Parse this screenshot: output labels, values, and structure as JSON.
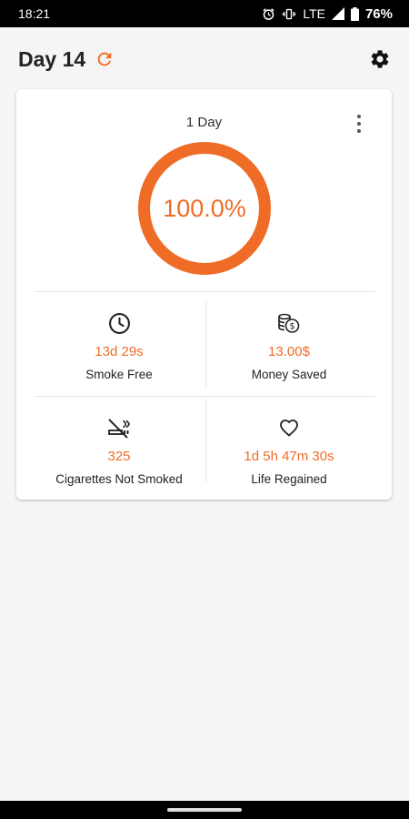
{
  "status_bar": {
    "time": "18:21",
    "network": "LTE",
    "battery": "76%"
  },
  "app_bar": {
    "title": "Day 14",
    "refresh_icon": "refresh-icon",
    "settings_icon": "gear-icon"
  },
  "progress_card": {
    "period": "1 Day",
    "percent_text": "100.0%",
    "progress_fraction": 1.0,
    "accent_color": "#ef6c27"
  },
  "stats": [
    {
      "icon": "clock-icon",
      "value": "13d 29s",
      "label": "Smoke Free"
    },
    {
      "icon": "coins-icon",
      "value": "13.00$",
      "label": "Money Saved"
    },
    {
      "icon": "no-smoking-icon",
      "value": "325",
      "label": "Cigarettes Not Smoked"
    },
    {
      "icon": "heart-icon",
      "value": "1d 5h 47m 30s",
      "label": "Life Regained"
    }
  ]
}
